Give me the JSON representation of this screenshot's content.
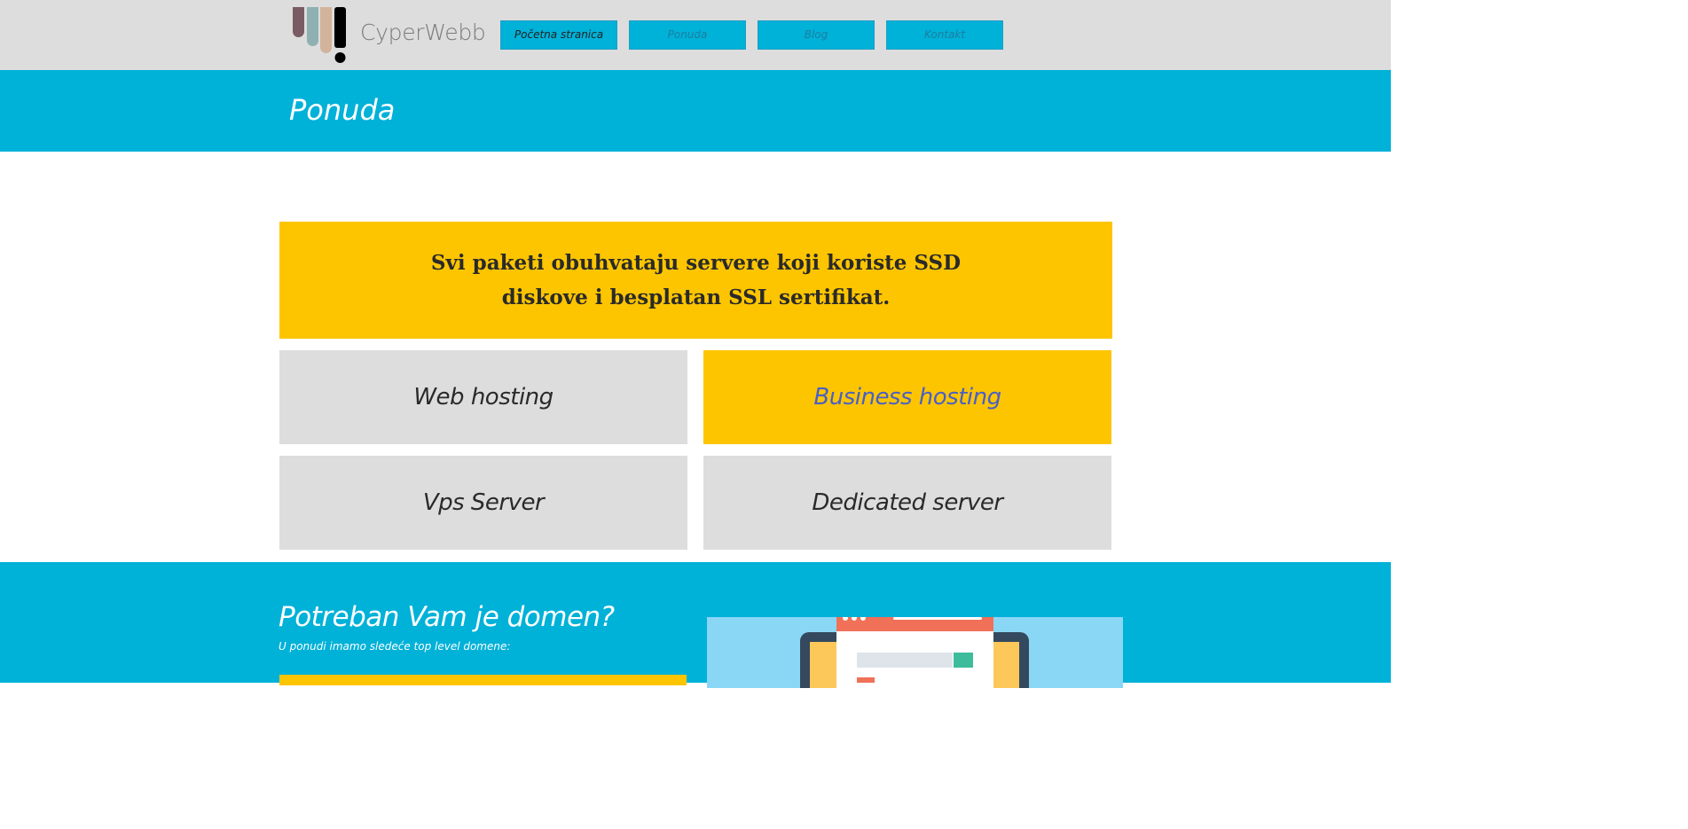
{
  "header": {
    "brand": "CyperWebb",
    "logo_icon": "logo-icon",
    "nav": [
      {
        "label": "Početna stranica",
        "active": true
      },
      {
        "label": "Ponuda",
        "active": false
      },
      {
        "label": "Blog",
        "active": false
      },
      {
        "label": "Kontakt",
        "active": false
      }
    ]
  },
  "page": {
    "title": "Ponuda"
  },
  "notice": {
    "text": "Svi paketi obuhvataju servere koji koriste SSD diskove i besplatan SSL sertifikat."
  },
  "packages": [
    {
      "label": "Web hosting"
    },
    {
      "label": "Business hosting"
    },
    {
      "label": "Vps Server"
    },
    {
      "label": "Dedicated server"
    }
  ],
  "domain": {
    "title": "Potreban Vam je domen?",
    "subtitle": "U ponudi imamo sledeće top level domene:",
    "illustration_icon": "browser-window-icon"
  },
  "colors": {
    "accent_blue": "#00b1d8",
    "accent_yellow": "#fdc500",
    "header_gray": "#dddddd",
    "highlight_text": "#4a5fc6"
  }
}
